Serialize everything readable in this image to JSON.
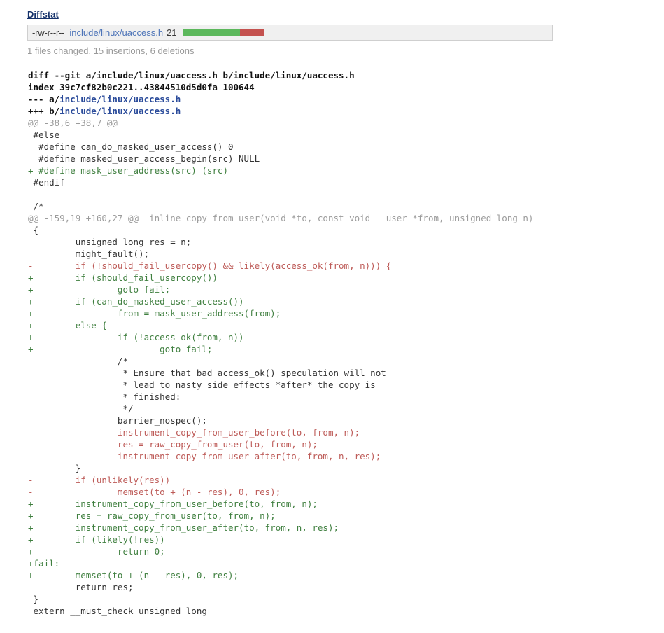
{
  "diffstat": {
    "heading": "Diffstat",
    "file_mode": "-rw-r--r--",
    "file_path": "include/linux/uaccess.h",
    "change_count": "21",
    "bar": {
      "add_width_pct": 71,
      "del_width_pct": 29,
      "add_color": "#5cb85c",
      "del_color": "#c4524f"
    },
    "summary": "1 files changed, 15 insertions, 6 deletions"
  },
  "diff": {
    "lines": [
      {
        "kind": "meta",
        "text": "diff --git a/include/linux/uaccess.h b/include/linux/uaccess.h"
      },
      {
        "kind": "meta",
        "text": "index 39c7cf82b0c221..43844510d5d0fa 100644"
      },
      {
        "kind": "meta-path",
        "prefix": "--- a/",
        "path": "include/linux/uaccess.h"
      },
      {
        "kind": "meta-path",
        "prefix": "+++ b/",
        "path": "include/linux/uaccess.h"
      },
      {
        "kind": "hunk",
        "text": "@@ -38,6 +38,7 @@"
      },
      {
        "kind": "ctx",
        "text": " #else"
      },
      {
        "kind": "ctx",
        "text": "  #define can_do_masked_user_access() 0"
      },
      {
        "kind": "ctx",
        "text": "  #define masked_user_access_begin(src) NULL"
      },
      {
        "kind": "add",
        "text": "+ #define mask_user_address(src) (src)"
      },
      {
        "kind": "ctx",
        "text": " #endif"
      },
      {
        "kind": "ctx",
        "text": " "
      },
      {
        "kind": "ctx",
        "text": " /*"
      },
      {
        "kind": "hunk",
        "text": "@@ -159,19 +160,27 @@ _inline_copy_from_user(void *to, const void __user *from, unsigned long n)"
      },
      {
        "kind": "ctx",
        "text": " {"
      },
      {
        "kind": "ctx",
        "text": "         unsigned long res = n;"
      },
      {
        "kind": "ctx",
        "text": "         might_fault();"
      },
      {
        "kind": "del",
        "text": "-        if (!should_fail_usercopy() && likely(access_ok(from, n))) {"
      },
      {
        "kind": "add",
        "text": "+        if (should_fail_usercopy())"
      },
      {
        "kind": "add",
        "text": "+                goto fail;"
      },
      {
        "kind": "add",
        "text": "+        if (can_do_masked_user_access())"
      },
      {
        "kind": "add",
        "text": "+                from = mask_user_address(from);"
      },
      {
        "kind": "add",
        "text": "+        else {"
      },
      {
        "kind": "add",
        "text": "+                if (!access_ok(from, n))"
      },
      {
        "kind": "add",
        "text": "+                        goto fail;"
      },
      {
        "kind": "ctx",
        "text": "                 /*"
      },
      {
        "kind": "ctx",
        "text": "                  * Ensure that bad access_ok() speculation will not"
      },
      {
        "kind": "ctx",
        "text": "                  * lead to nasty side effects *after* the copy is"
      },
      {
        "kind": "ctx",
        "text": "                  * finished:"
      },
      {
        "kind": "ctx",
        "text": "                  */"
      },
      {
        "kind": "ctx",
        "text": "                 barrier_nospec();"
      },
      {
        "kind": "del",
        "text": "-                instrument_copy_from_user_before(to, from, n);"
      },
      {
        "kind": "del",
        "text": "-                res = raw_copy_from_user(to, from, n);"
      },
      {
        "kind": "del",
        "text": "-                instrument_copy_from_user_after(to, from, n, res);"
      },
      {
        "kind": "ctx",
        "text": "         }"
      },
      {
        "kind": "del",
        "text": "-        if (unlikely(res))"
      },
      {
        "kind": "del",
        "text": "-                memset(to + (n - res), 0, res);"
      },
      {
        "kind": "add",
        "text": "+        instrument_copy_from_user_before(to, from, n);"
      },
      {
        "kind": "add",
        "text": "+        res = raw_copy_from_user(to, from, n);"
      },
      {
        "kind": "add",
        "text": "+        instrument_copy_from_user_after(to, from, n, res);"
      },
      {
        "kind": "add",
        "text": "+        if (likely(!res))"
      },
      {
        "kind": "add",
        "text": "+                return 0;"
      },
      {
        "kind": "add",
        "text": "+fail:"
      },
      {
        "kind": "add",
        "text": "+        memset(to + (n - res), 0, res);"
      },
      {
        "kind": "ctx",
        "text": "         return res;"
      },
      {
        "kind": "ctx",
        "text": " }"
      },
      {
        "kind": "ctx",
        "text": " extern __must_check unsigned long"
      }
    ]
  }
}
